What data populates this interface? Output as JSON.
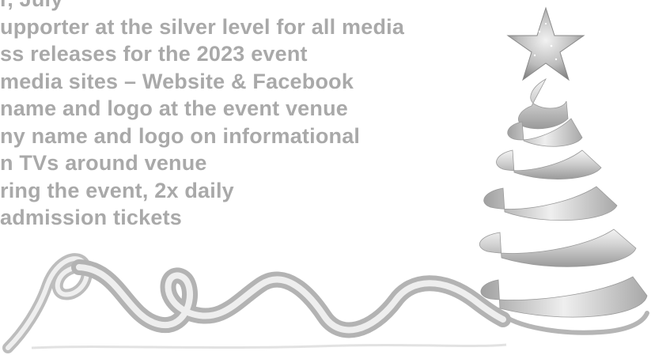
{
  "benefits": {
    "lines": [
      "r, July",
      "upporter at the silver level for all media",
      "ss releases for the 2023 event",
      "media sites – Website & Facebook",
      "name and logo at the event venue",
      "ny name and logo on informational",
      "n TVs around venue",
      "ring the event, 2x daily",
      "admission tickets"
    ]
  },
  "colors": {
    "text": "#a9a9a9",
    "ribbon_light": "#ececec",
    "ribbon_mid": "#c9c9c9",
    "ribbon_dark": "#8f8f8f",
    "background": "#ffffff"
  },
  "decorations": {
    "star": "star-icon",
    "ribbon_tree": "ribbon-tree",
    "ribbon_curl": "ribbon-curl"
  }
}
